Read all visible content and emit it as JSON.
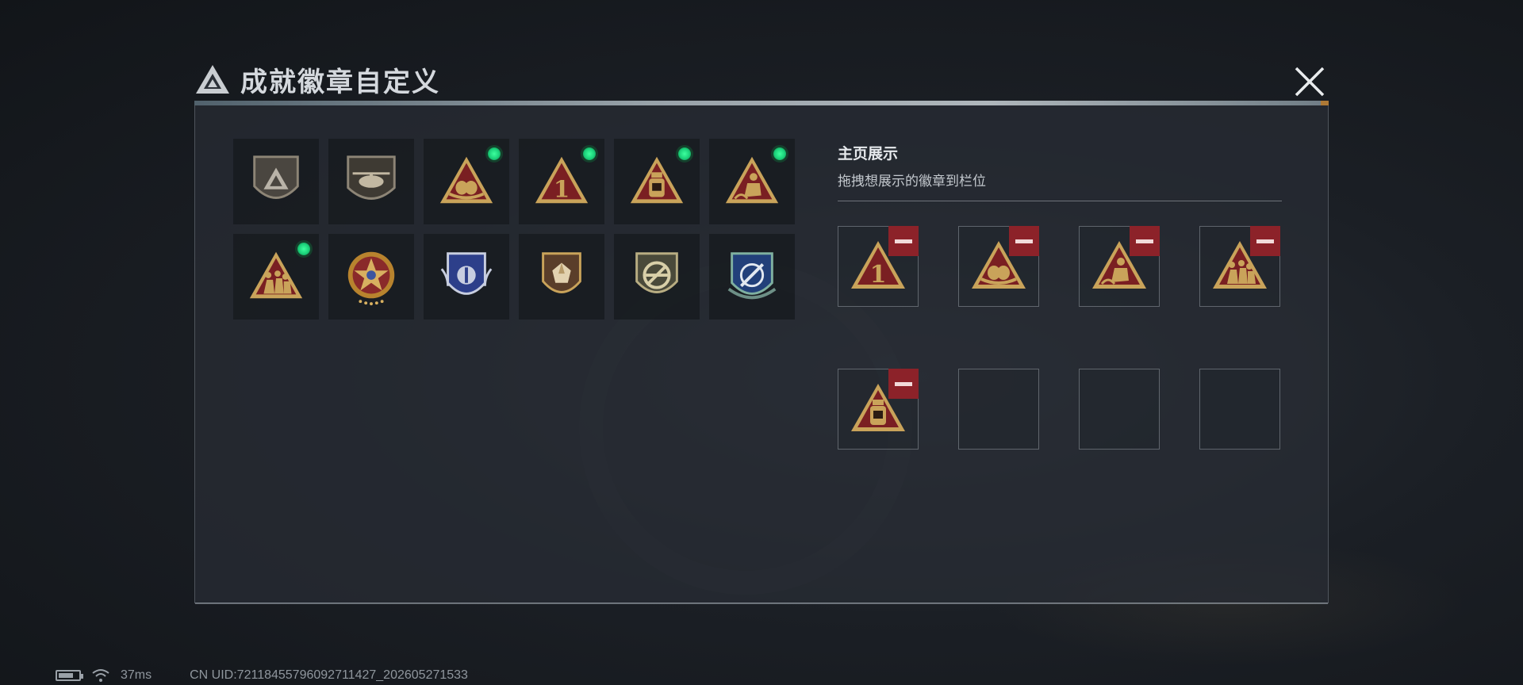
{
  "header": {
    "title": "成就徽章自定义"
  },
  "inventory": {
    "badges": [
      {
        "icon": "silver-triangle-shield-badge-icon",
        "new": false
      },
      {
        "icon": "helicopter-shield-badge-icon",
        "new": false
      },
      {
        "icon": "gold-triangle-eggs-badge-icon",
        "new": true
      },
      {
        "icon": "gold-triangle-number-one-badge-icon",
        "new": true
      },
      {
        "icon": "gold-triangle-helmet-badge-icon",
        "new": true
      },
      {
        "icon": "gold-triangle-kneeling-figure-badge-icon",
        "new": true
      },
      {
        "icon": "gold-triangle-soldiers-badge-icon",
        "new": true
      },
      {
        "icon": "star-medallion-badge-icon",
        "new": false
      },
      {
        "icon": "blue-winged-shield-badge-icon",
        "new": false
      },
      {
        "icon": "gem-shield-badge-icon",
        "new": false
      },
      {
        "icon": "no-rifle-shield-badge-icon",
        "new": false
      },
      {
        "icon": "blue-crosshair-wreath-badge-icon",
        "new": false
      }
    ]
  },
  "showcase": {
    "title": "主页展示",
    "subtitle": "拖拽想展示的徽章到栏位",
    "slots": [
      {
        "icon": "gold-triangle-number-one-badge-icon",
        "filled": true
      },
      {
        "icon": "gold-triangle-eggs-badge-icon",
        "filled": true
      },
      {
        "icon": "gold-triangle-kneeling-figure-badge-icon",
        "filled": true
      },
      {
        "icon": "gold-triangle-soldiers-badge-icon",
        "filled": true
      },
      {
        "icon": "gold-triangle-helmet-badge-icon",
        "filled": true
      },
      {
        "icon": "",
        "filled": false
      },
      {
        "icon": "",
        "filled": false
      },
      {
        "icon": "",
        "filled": false
      }
    ]
  },
  "status_bar": {
    "latency": "37ms",
    "uid": "CN UID:7211845579609271142​7_202605271533"
  },
  "colors": {
    "accent_red": "#8c2229",
    "new_indicator": "#1bd17a",
    "badge_gold": "#c9a35a",
    "badge_red": "#7a1f22"
  }
}
